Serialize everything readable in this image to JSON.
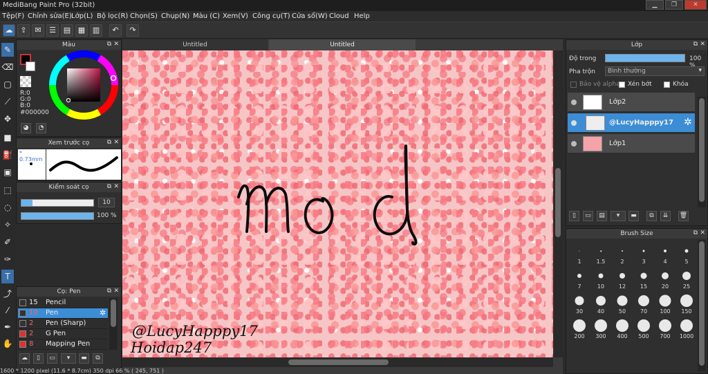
{
  "window": {
    "title": "MediBang Paint Pro (32bit)",
    "min": "▁",
    "max": "❐",
    "close": "✕"
  },
  "menu": [
    "Tệp(F)",
    "Chỉnh sửa(E)",
    "Lớp(L)",
    "Bộ lọc(R)",
    "Chọn(S)",
    "Chụp(N)",
    "Màu (C)",
    "Xem(V)",
    "Công cụ(T)",
    "Cửa sổ(W)",
    "Cloud",
    "Help"
  ],
  "tabs": [
    "Untitled",
    "Untitled"
  ],
  "color_panel": {
    "title": "Màu",
    "r": "R:0",
    "g": "G:0",
    "b": "B:0",
    "hex": "#000000",
    "primary_color": "#000000",
    "secondary_color": "#ffffff"
  },
  "preview_panel": {
    "title": "Xem trước cọ",
    "size": "* 0.73mm"
  },
  "control_panel": {
    "title": "Kiểm soát cọ",
    "size_value": "10",
    "opacity_value": "100 %",
    "size_fraction": 0.15,
    "opacity_fraction": 1.0
  },
  "brush_panel": {
    "title": "Cọ: Pen",
    "items": [
      {
        "size": "15",
        "name": "Pencil",
        "color": "#333333"
      },
      {
        "size": "10",
        "name": "Pen",
        "color": "#333333"
      },
      {
        "size": "2",
        "name": "Pen (Sharp)",
        "color": "#333333"
      },
      {
        "size": "2",
        "name": "G Pen",
        "color": "#e03030"
      },
      {
        "size": "8",
        "name": "Mapping Pen",
        "color": "#e03030"
      }
    ]
  },
  "layer_panel": {
    "title": "Lớp",
    "opacity_label": "Độ trong",
    "opacity_value": "100 %",
    "opacity_fraction": 1.0,
    "blend_label": "Pha trộn",
    "blend_value": "Bình thường",
    "protect_alpha": "Bảo vệ alpha",
    "clipping": "Xén bớt",
    "lock": "Khóa",
    "layers": [
      {
        "name": "Lớp2"
      },
      {
        "name": "@LucyHapppy17"
      },
      {
        "name": "Lớp1"
      }
    ]
  },
  "brush_size_panel": {
    "title": "Brush Size",
    "sizes": [
      "1",
      "1.5",
      "2",
      "3",
      "4",
      "5",
      "7",
      "10",
      "12",
      "15",
      "20",
      "25",
      "30",
      "40",
      "50",
      "70",
      "100",
      "150",
      "200",
      "300",
      "400",
      "500",
      "700",
      "1000"
    ]
  },
  "canvas_text": {
    "main": "mod",
    "watermark1": "@LucyHapppy17",
    "watermark2": "Hoidap247"
  },
  "status": "1600 * 1200 pixel   (11.6 * 8.7cm)   350 dpi   66 %   ( 245, 751 )"
}
